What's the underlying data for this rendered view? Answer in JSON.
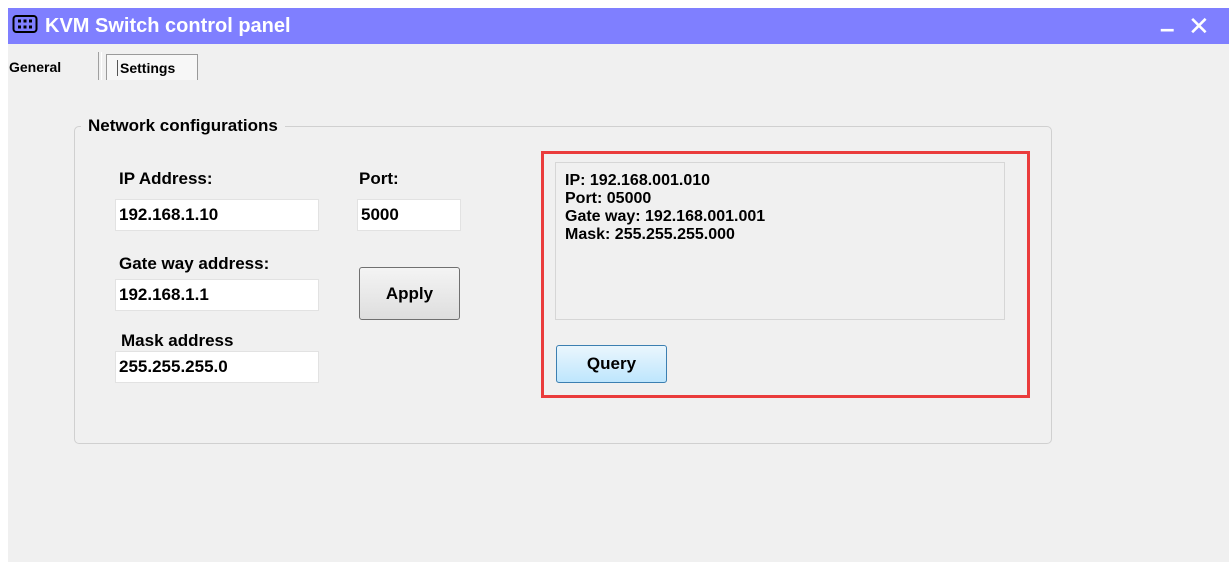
{
  "window": {
    "title": "KVM Switch control panel",
    "minimize_label": "–",
    "close_label": "✕",
    "icon": "kvm-device-icon",
    "titlebar_color": "#7f7fff"
  },
  "tabs": [
    {
      "label": "General",
      "selected": false
    },
    {
      "label": "Settings",
      "selected": true
    }
  ],
  "network": {
    "group_title": "Network configurations",
    "ip_label": "IP Address:",
    "ip_value": "192.168.1.10",
    "port_label": "Port:",
    "port_value": "5000",
    "gateway_label": "Gate way address:",
    "gateway_value": "192.168.1.1",
    "mask_label": "Mask address",
    "mask_value": "255.255.255.0",
    "apply_label": "Apply"
  },
  "query_panel": {
    "lines": [
      "IP: 192.168.001.010",
      "Port: 05000",
      "Gate way: 192.168.001.001",
      "Mask: 255.255.255.000"
    ],
    "query_label": "Query",
    "highlight_color": "#ea3c3c"
  }
}
